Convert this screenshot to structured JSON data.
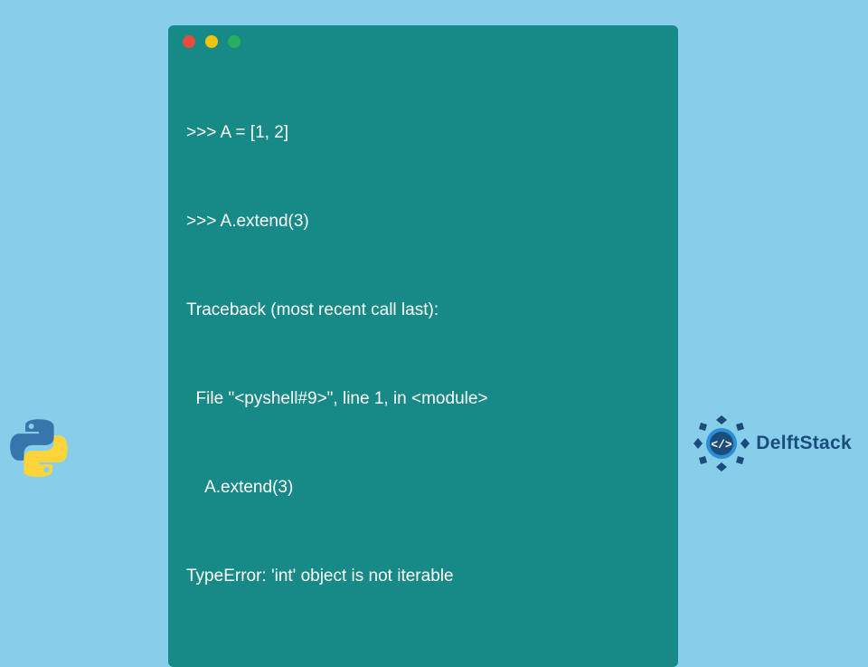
{
  "terminal": {
    "lines": [
      ">>> A = [1, 2]",
      ">>> A.extend(3)",
      "Traceback (most recent call last):",
      "  File \"<pyshell#9>\", line 1, in <module>",
      "    A.extend(3)",
      "TypeError: 'int' object is not iterable"
    ]
  },
  "branding": {
    "delftstack_label": "DelftStack"
  },
  "colors": {
    "page_bg": "#87ceeb",
    "terminal_bg": "#178a87",
    "terminal_fg": "#ffffff",
    "dot_red": "#e74c3c",
    "dot_yellow": "#f1c40f",
    "dot_green": "#27ae60",
    "delft_blue": "#1b4d7a",
    "python_blue": "#3776ab",
    "python_yellow": "#ffd43b"
  }
}
